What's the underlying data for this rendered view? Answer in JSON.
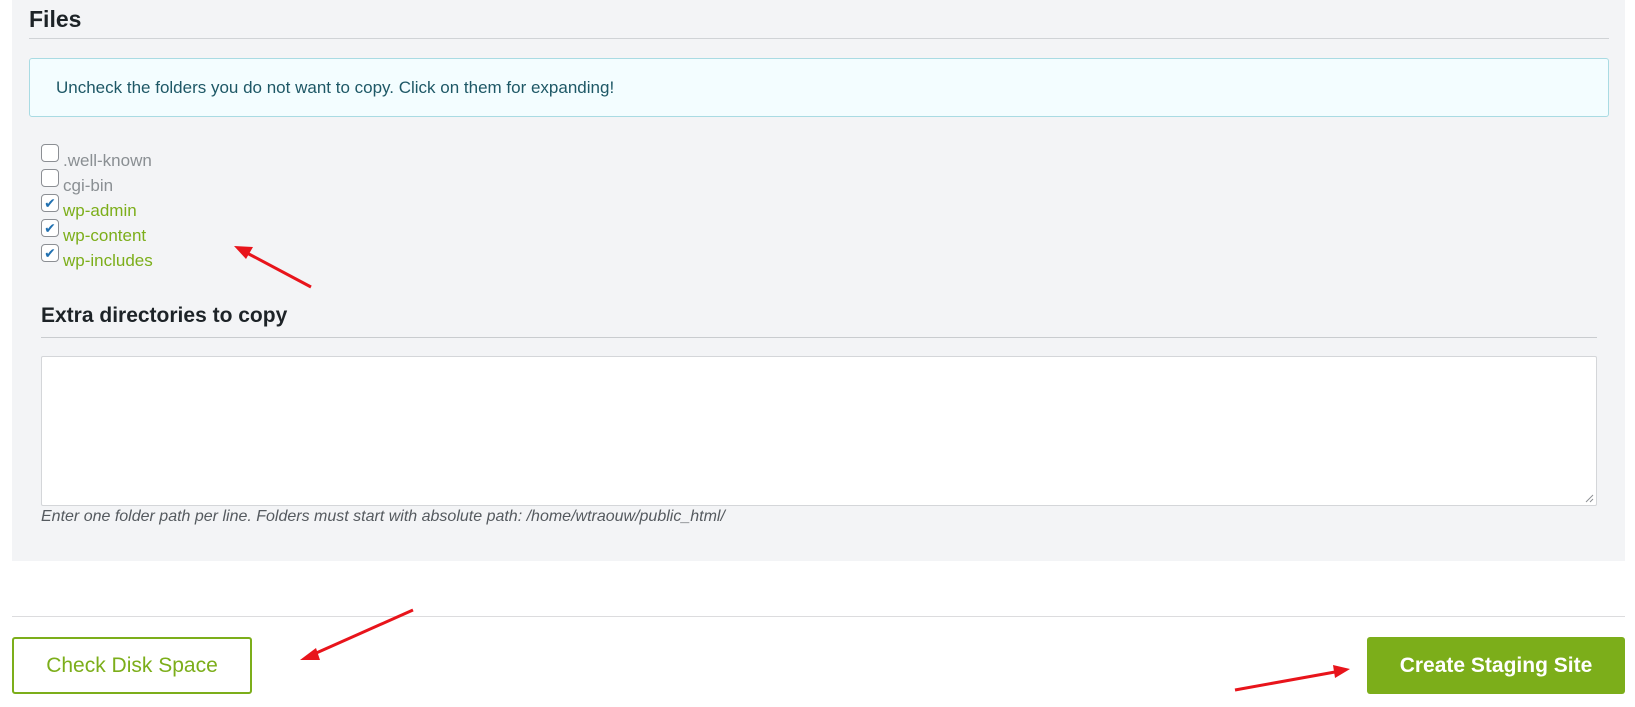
{
  "files": {
    "title": "Files",
    "notice": "Uncheck the folders you do not want to copy. Click on them for expanding!",
    "folders": [
      {
        "label": ".well-known",
        "checked": false
      },
      {
        "label": "cgi-bin",
        "checked": false
      },
      {
        "label": "wp-admin",
        "checked": true
      },
      {
        "label": "wp-content",
        "checked": true
      },
      {
        "label": "wp-includes",
        "checked": true
      }
    ]
  },
  "extra": {
    "title": "Extra directories to copy",
    "value": "",
    "help": "Enter one folder path per line. Folders must start with absolute path: /home/wtraouw/public_html/"
  },
  "actions": {
    "check_disk_space": "Check Disk Space",
    "create_staging_site": "Create Staging Site"
  },
  "colors": {
    "accent": "#7cae1a",
    "annotation_arrow": "#e8141b"
  }
}
